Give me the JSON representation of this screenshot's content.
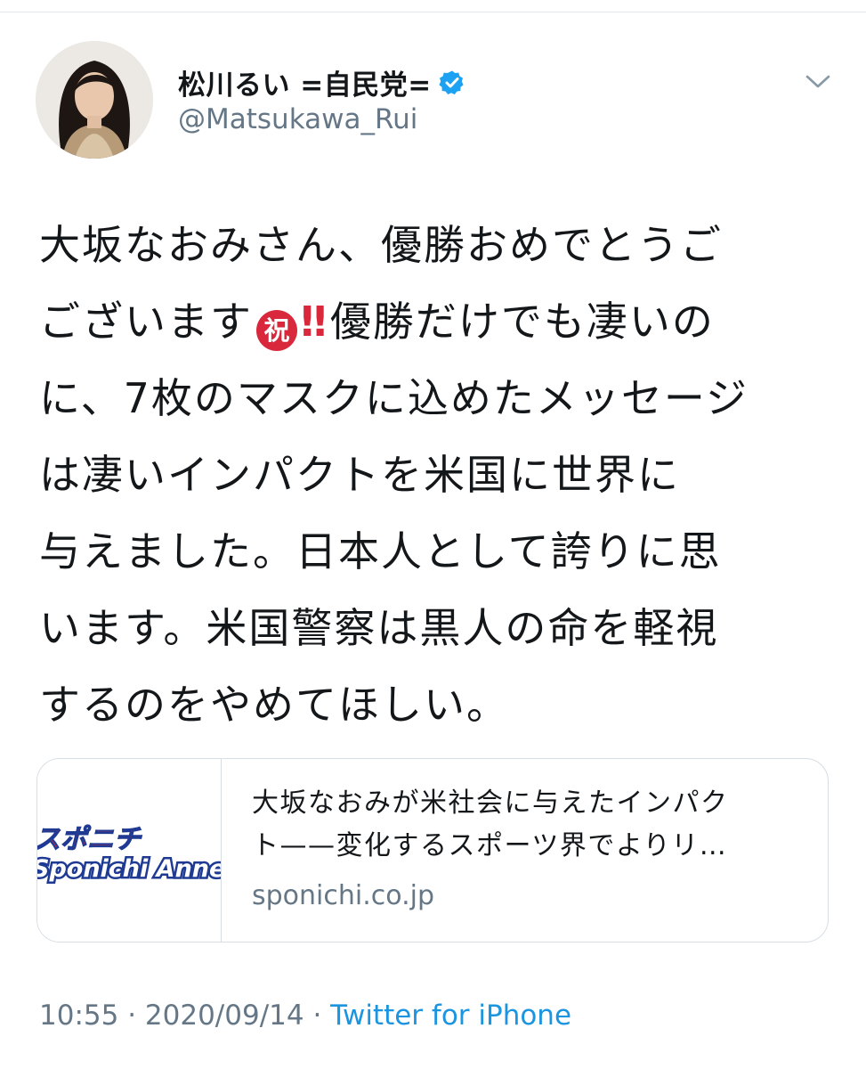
{
  "user": {
    "display_name": "松川るい =自民党=",
    "handle": "@Matsukawa_Rui",
    "verified": true
  },
  "tweet": {
    "lines": [
      "大坂なおみさん、優勝おめでとうご",
      "ございます",
      "優勝だけでも凄いの",
      "に、7枚のマスクに込めたメッセージ",
      "は凄いインパクトを米国に世界に",
      "与えました。日本人として誇りに思",
      "います。米国警察は黒人の命を軽視",
      "するのをやめてほしい。"
    ],
    "emoji_iwai": "祝",
    "emoji_bangbang": "‼"
  },
  "card": {
    "thumb_text_top": "スポニチ",
    "thumb_text_bottom": "Sponichi Annex",
    "title_line1": "大坂なおみが米社会に与えたインパク",
    "title_line2": "ト——変化するスポーツ界でよりリ…",
    "domain": "sponichi.co.jp"
  },
  "meta": {
    "time": "10:55",
    "separator": " · ",
    "date": "2020/09/14",
    "source": "Twitter for iPhone"
  },
  "colors": {
    "text": "#14171a",
    "secondary": "#657786",
    "link": "#1b95e0",
    "verified": "#1da1f2",
    "emoji_red": "#d9283c"
  },
  "icons": [
    "verified-badge-icon",
    "chevron-down-icon"
  ]
}
